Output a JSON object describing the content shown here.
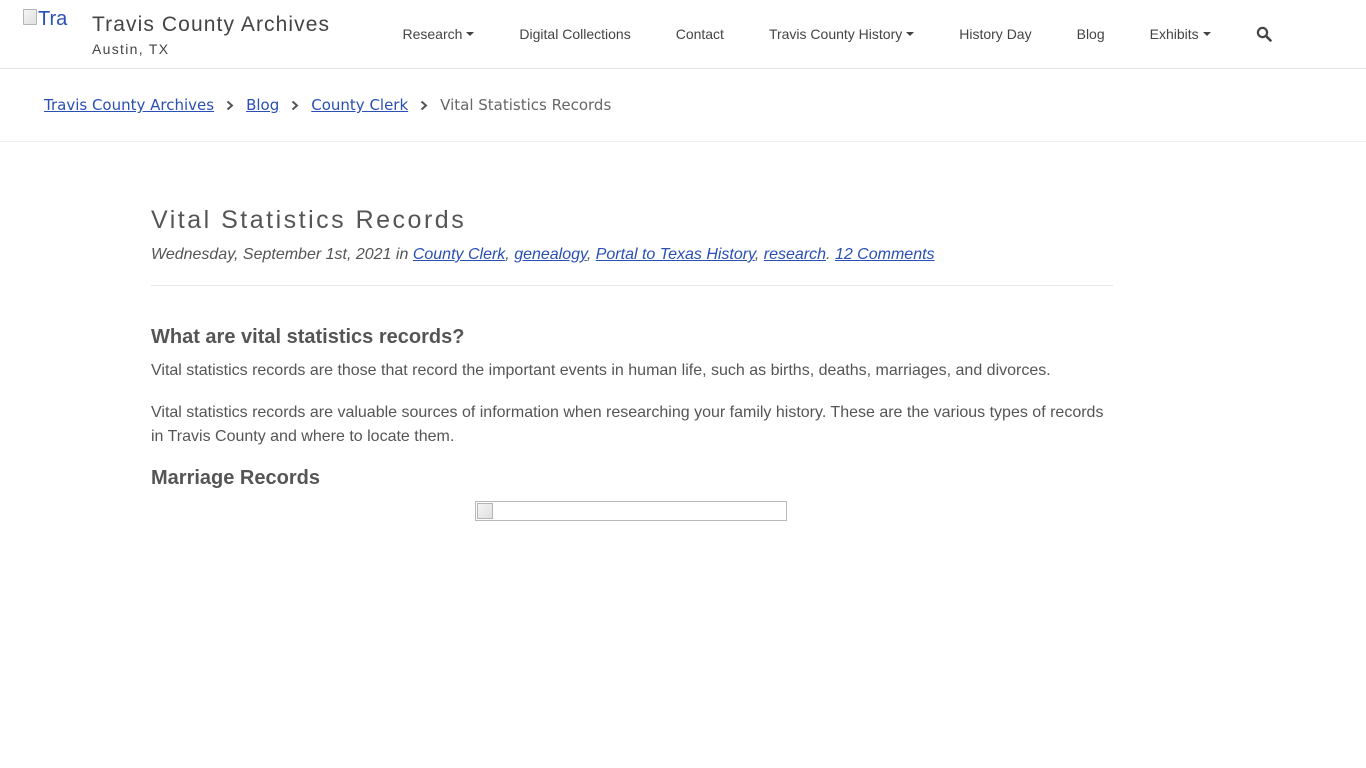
{
  "header": {
    "logo_alt": "Tra",
    "site_title": "Travis County Archives",
    "site_subtitle": "Austin, TX",
    "nav": [
      {
        "label": "Research",
        "dropdown": true
      },
      {
        "label": "Digital Collections",
        "dropdown": false
      },
      {
        "label": "Contact",
        "dropdown": false
      },
      {
        "label": "Travis County History",
        "dropdown": true
      },
      {
        "label": "History Day",
        "dropdown": false
      },
      {
        "label": "Blog",
        "dropdown": false
      },
      {
        "label": "Exhibits",
        "dropdown": true
      }
    ],
    "search_icon": "search-icon"
  },
  "breadcrumb": {
    "items": [
      "Travis County Archives",
      "Blog",
      "County Clerk"
    ],
    "current": "Vital Statistics Records",
    "separator_icon": "chevron-right-icon"
  },
  "post": {
    "title": "Vital Statistics Records",
    "date": "Wednesday, September 1st, 2021",
    "in_word": "in",
    "categories": [
      "County Clerk",
      "genealogy",
      "Portal to Texas History",
      "research"
    ],
    "comments": "12 Comments",
    "sections": {
      "h1": "What are vital statistics records?",
      "p1": "Vital statistics records are those that record the important events in human life, such as births, deaths, marriages, and divorces.",
      "p2": "Vital statistics records are valuable sources of information when researching your family history. These are the various types of records in Travis County and where to locate them.",
      "h2": "Marriage Records"
    }
  },
  "colors": {
    "link": "#2a4fb5",
    "text": "#555555",
    "border": "#e5e5e5"
  }
}
